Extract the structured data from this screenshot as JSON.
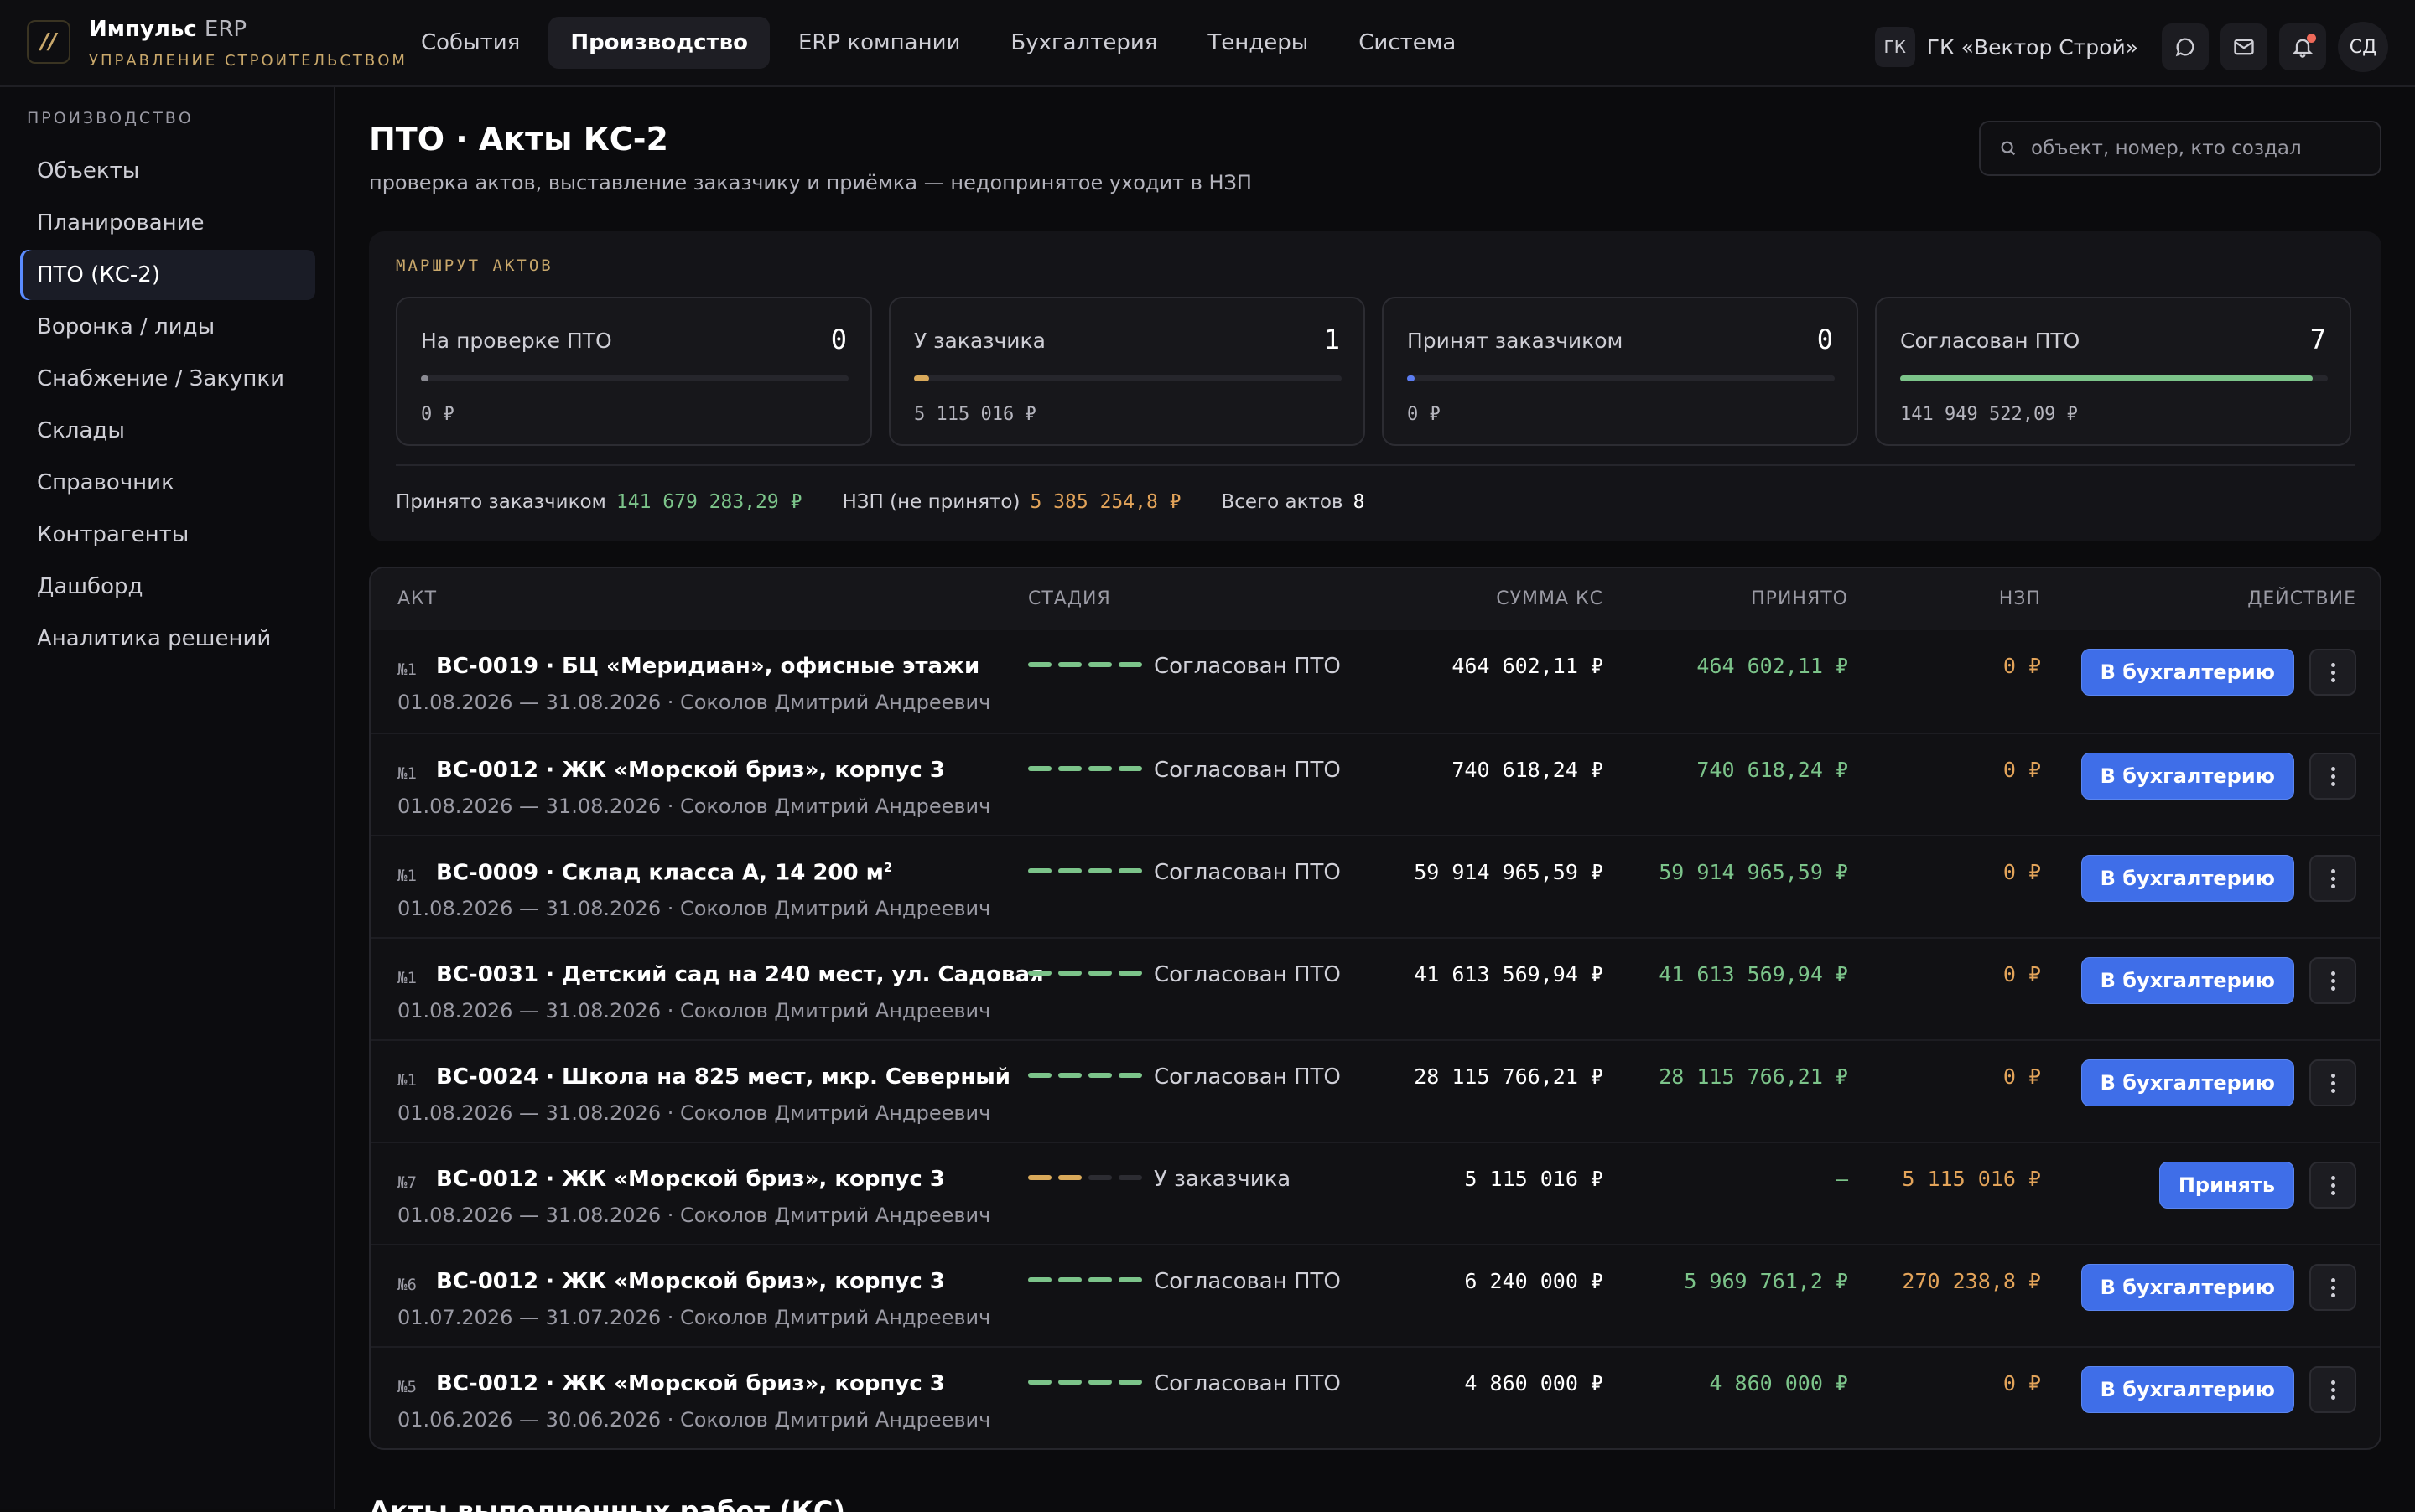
{
  "app": {
    "title": "Импульс",
    "title_suffix": "ERP",
    "subtitle": "УПРАВЛЕНИЕ СТРОИТЕЛЬСТВОМ",
    "logo_glyph": "//"
  },
  "nav": [
    {
      "label": "События",
      "active": false
    },
    {
      "label": "Производство",
      "active": true
    },
    {
      "label": "ERP компании",
      "active": false
    },
    {
      "label": "Бухгалтерия",
      "active": false
    },
    {
      "label": "Тендеры",
      "active": false
    },
    {
      "label": "Система",
      "active": false
    }
  ],
  "org": {
    "badge": "ГК",
    "name": "ГК «Вектор Строй»"
  },
  "user": {
    "initials": "СД"
  },
  "icons": {
    "chat": "chat-icon",
    "mail": "mail-icon",
    "bell": "bell-icon",
    "search": "search-icon",
    "more": "more-vertical-icon"
  },
  "sidebar": {
    "title": "ПРОИЗВОДСТВО",
    "items": [
      {
        "label": "Объекты",
        "active": false
      },
      {
        "label": "Планирование",
        "active": false
      },
      {
        "label": "ПТО (КС-2)",
        "active": true
      },
      {
        "label": "Воронка / лиды",
        "active": false
      },
      {
        "label": "Снабжение / Закупки",
        "active": false
      },
      {
        "label": "Склады",
        "active": false
      },
      {
        "label": "Справочник",
        "active": false
      },
      {
        "label": "Контрагенты",
        "active": false
      },
      {
        "label": "Дашборд",
        "active": false
      },
      {
        "label": "Аналитика решений",
        "active": false
      }
    ]
  },
  "page": {
    "title": "ПТО · Акты КС-2",
    "subtitle": "проверка актов, выставление заказчику и приёмка — недопринятое уходит в НЗП",
    "search_placeholder": "объект, номер, кто создал",
    "search_value": ""
  },
  "route": {
    "label": "МАРШРУТ АКТОВ",
    "stages": [
      {
        "name": "На проверке ПТО",
        "count": "0",
        "sum": "0 ₽",
        "fill": 0.0,
        "color": "#8a8a92"
      },
      {
        "name": "У заказчика",
        "count": "1",
        "sum": "5 115 016 ₽",
        "fill": 0.035,
        "color": "#d9a95a"
      },
      {
        "name": "Принят заказчиком",
        "count": "0",
        "sum": "0 ₽",
        "fill": 0.0,
        "color": "#5b7cf0"
      },
      {
        "name": "Согласован ПТО",
        "count": "7",
        "sum": "141 949 522,09 ₽",
        "fill": 0.965,
        "color": "#7cc48a"
      }
    ],
    "totals": {
      "accepted_label": "Принято заказчиком",
      "accepted_value": "141 679 283,29 ₽",
      "nzp_label": "НЗП (не принято)",
      "nzp_value": "5 385 254,8 ₽",
      "count_label": "Всего актов",
      "count_value": "8"
    }
  },
  "table": {
    "headers": {
      "act": "АКТ",
      "stage": "СТАДИЯ",
      "sum": "СУММА КС",
      "accepted": "ПРИНЯТО",
      "nzp": "НЗП",
      "action": "ДЕЙСТВИЕ"
    },
    "rows": [
      {
        "no": "№1",
        "title": "ВС-0019 · БЦ «Меридиан», офисные этажи",
        "meta": "01.08.2026 — 31.08.2026 · Соколов Дмитрий Андреевич",
        "steps": 4,
        "step_color": "green",
        "stage": "Согласован ПТО",
        "sum": "464 602,11 ₽",
        "accepted": "464 602,11 ₽",
        "nzp": "0 ₽",
        "action": "В бухгалтерию"
      },
      {
        "no": "№1",
        "title": "ВС-0012 · ЖК «Морской бриз», корпус 3",
        "meta": "01.08.2026 — 31.08.2026 · Соколов Дмитрий Андреевич",
        "steps": 4,
        "step_color": "green",
        "stage": "Согласован ПТО",
        "sum": "740 618,24 ₽",
        "accepted": "740 618,24 ₽",
        "nzp": "0 ₽",
        "action": "В бухгалтерию"
      },
      {
        "no": "№1",
        "title": "ВС-0009 · Склад класса А, 14 200 м",
        "title_sup": "2",
        "meta": "01.08.2026 — 31.08.2026 · Соколов Дмитрий Андреевич",
        "steps": 4,
        "step_color": "green",
        "stage": "Согласован ПТО",
        "sum": "59 914 965,59 ₽",
        "accepted": "59 914 965,59 ₽",
        "nzp": "0 ₽",
        "action": "В бухгалтерию"
      },
      {
        "no": "№1",
        "title": "ВС-0031 · Детский сад на 240 мест, ул. Садовая",
        "meta": "01.08.2026 — 31.08.2026 · Соколов Дмитрий Андреевич",
        "steps": 4,
        "step_color": "green",
        "stage": "Согласован ПТО",
        "sum": "41 613 569,94 ₽",
        "accepted": "41 613 569,94 ₽",
        "nzp": "0 ₽",
        "action": "В бухгалтерию"
      },
      {
        "no": "№1",
        "title": "ВС-0024 · Школа на 825 мест, мкр. Северный",
        "meta": "01.08.2026 — 31.08.2026 · Соколов Дмитрий Андреевич",
        "steps": 4,
        "step_color": "green",
        "stage": "Согласован ПТО",
        "sum": "28 115 766,21 ₽",
        "accepted": "28 115 766,21 ₽",
        "nzp": "0 ₽",
        "action": "В бухгалтерию"
      },
      {
        "no": "№7",
        "title": "ВС-0012 · ЖК «Морской бриз», корпус 3",
        "meta": "01.08.2026 — 31.08.2026 · Соколов Дмитрий Андреевич",
        "steps": 2,
        "step_color": "amber",
        "stage": "У заказчика",
        "sum": "5 115 016 ₽",
        "accepted": "—",
        "nzp": "5 115 016 ₽",
        "action": "Принять"
      },
      {
        "no": "№6",
        "title": "ВС-0012 · ЖК «Морской бриз», корпус 3",
        "meta": "01.07.2026 — 31.07.2026 · Соколов Дмитрий Андреевич",
        "steps": 4,
        "step_color": "green",
        "stage": "Согласован ПТО",
        "sum": "6 240 000 ₽",
        "accepted": "5 969 761,2 ₽",
        "nzp": "270 238,8 ₽",
        "action": "В бухгалтерию"
      },
      {
        "no": "№5",
        "title": "ВС-0012 · ЖК «Морской бриз», корпус 3",
        "meta": "01.06.2026 — 30.06.2026 · Соколов Дмитрий Андреевич",
        "steps": 4,
        "step_color": "green",
        "stage": "Согласован ПТО",
        "sum": "4 860 000 ₽",
        "accepted": "4 860 000 ₽",
        "nzp": "0 ₽",
        "action": "В бухгалтерию"
      }
    ]
  },
  "next_section": {
    "title": "Акты выполненных работ (КС)"
  }
}
